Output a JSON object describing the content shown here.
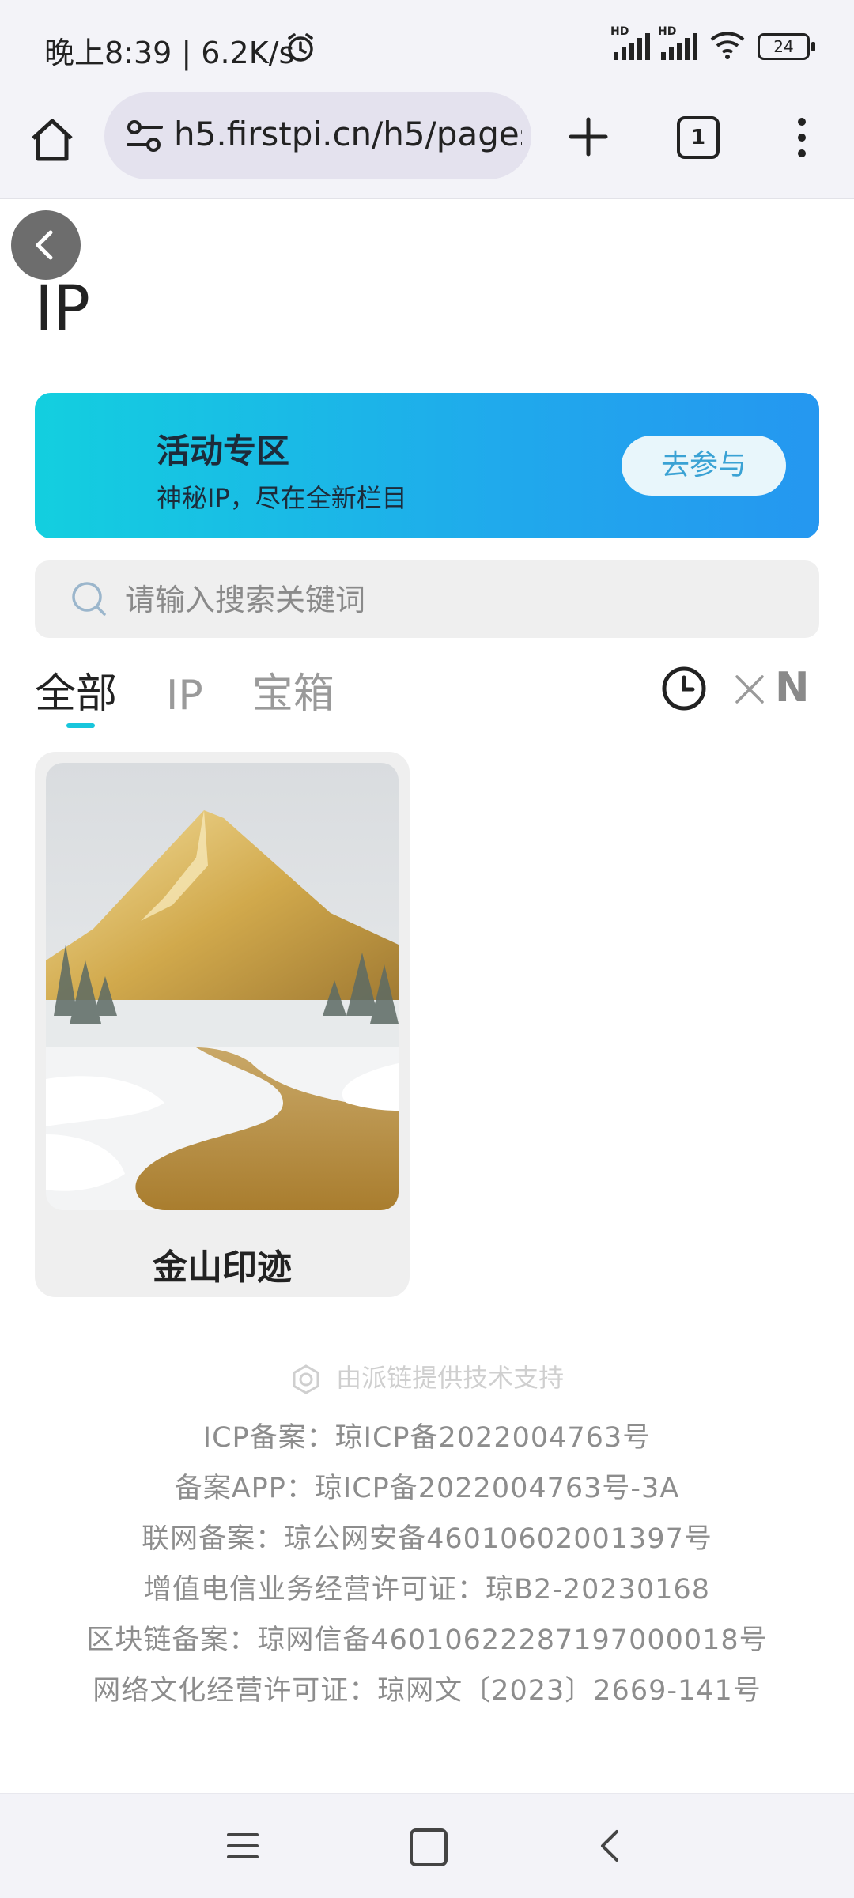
{
  "status_bar": {
    "time": "晚上8:39 | 6.2K/s",
    "battery": "24",
    "hd1": "HD",
    "hd2": "HD"
  },
  "browser": {
    "url": "h5.firstpi.cn/h5/pages",
    "tab_count": "1"
  },
  "page": {
    "title": "IP"
  },
  "banner": {
    "title": "活动专区",
    "subtitle": "神秘IP，尽在全新栏目",
    "button": "去参与"
  },
  "search": {
    "placeholder": "请输入搜索关键词",
    "value": ""
  },
  "tabs": [
    {
      "label": "全部",
      "active": true
    },
    {
      "label": "IP",
      "active": false
    },
    {
      "label": "宝箱",
      "active": false
    }
  ],
  "filter": {
    "n_label": "N"
  },
  "cards": [
    {
      "title": "金山印迹"
    }
  ],
  "footer": {
    "powered_by": "由派链提供技术支持",
    "lines": [
      "ICP备案：琼ICP备2022004763号",
      "备案APP：琼ICP备2022004763号-3A",
      "联网备案：琼公网安备46010602001397号",
      "增值电信业务经营许可证：琼B2-20230168",
      "区块链备案：琼网信备46010622287197000018号",
      "网络文化经营许可证：琼网文〔2023〕2669-141号"
    ]
  },
  "colors": {
    "accent": "#18c6dc",
    "banner_start": "#13cfdf",
    "banner_end": "#2597f0"
  }
}
